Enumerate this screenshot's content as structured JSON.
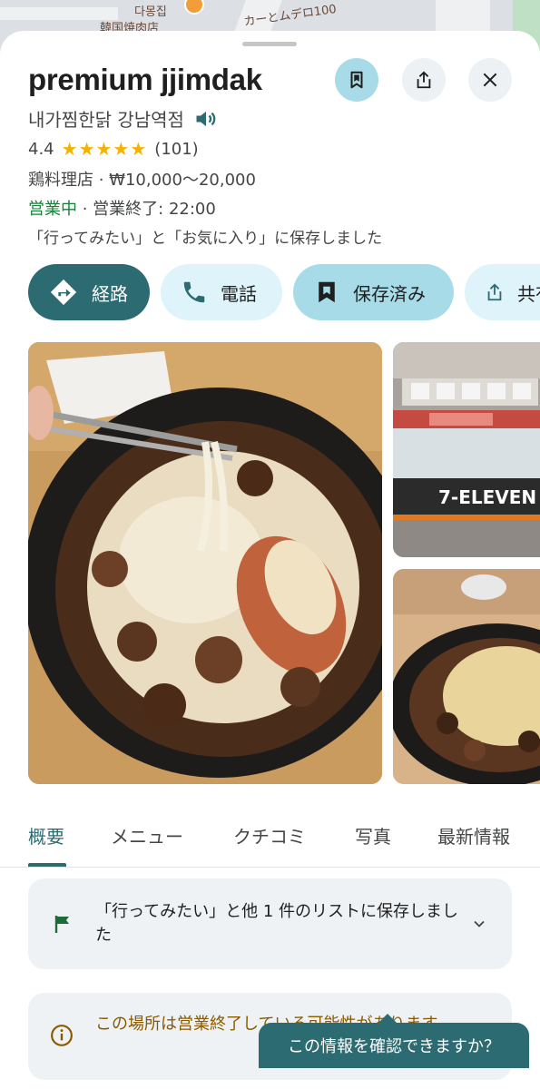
{
  "map": {
    "label_1": "다몽집",
    "label_2": "韓国焼肉店",
    "label_3": "カーとムデロ100"
  },
  "place": {
    "name": "premium jjimdak",
    "local_name": "내가찜한닭 강남역점",
    "rating": "4.4",
    "stars": "★★★★★",
    "review_count": "(101)",
    "category_price": "鶏料理店 · ₩10,000～20,000",
    "open_status": "営業中",
    "closing": " · 営業終了: 22:00",
    "saved_note": "「行ってみたい」と「お気に入り」に保存しました"
  },
  "actions": {
    "route": "経路",
    "call": "電話",
    "saved": "保存済み",
    "share": "共有"
  },
  "photos": {
    "store_sign": "7-ELEVEN"
  },
  "tabs": [
    "概要",
    "メニュー",
    "クチコミ",
    "写真",
    "最新情報"
  ],
  "cards": {
    "list_text": "「行ってみたい」と他 1 件のリストに保存しました",
    "closed_text": "この場所は営業終了している可能性があります"
  },
  "tooltip": "この情報を確認できますか？",
  "colors": {
    "accent": "#2d6b72",
    "saved_fill": "#a8dbe8",
    "chip_fill": "#dff3fa",
    "open_green": "#188038",
    "star": "#f5b300",
    "warning": "#8a5a00"
  },
  "icons": {
    "save_top": "bookmark-icon",
    "share_top": "share-icon",
    "close": "close-icon",
    "audio": "speaker-icon",
    "route": "directions-icon",
    "call": "phone-icon",
    "saved": "bookmark-icon",
    "share": "share-icon",
    "list": "flag-icon",
    "closed": "info-icon",
    "expand": "chevron-down-icon"
  }
}
